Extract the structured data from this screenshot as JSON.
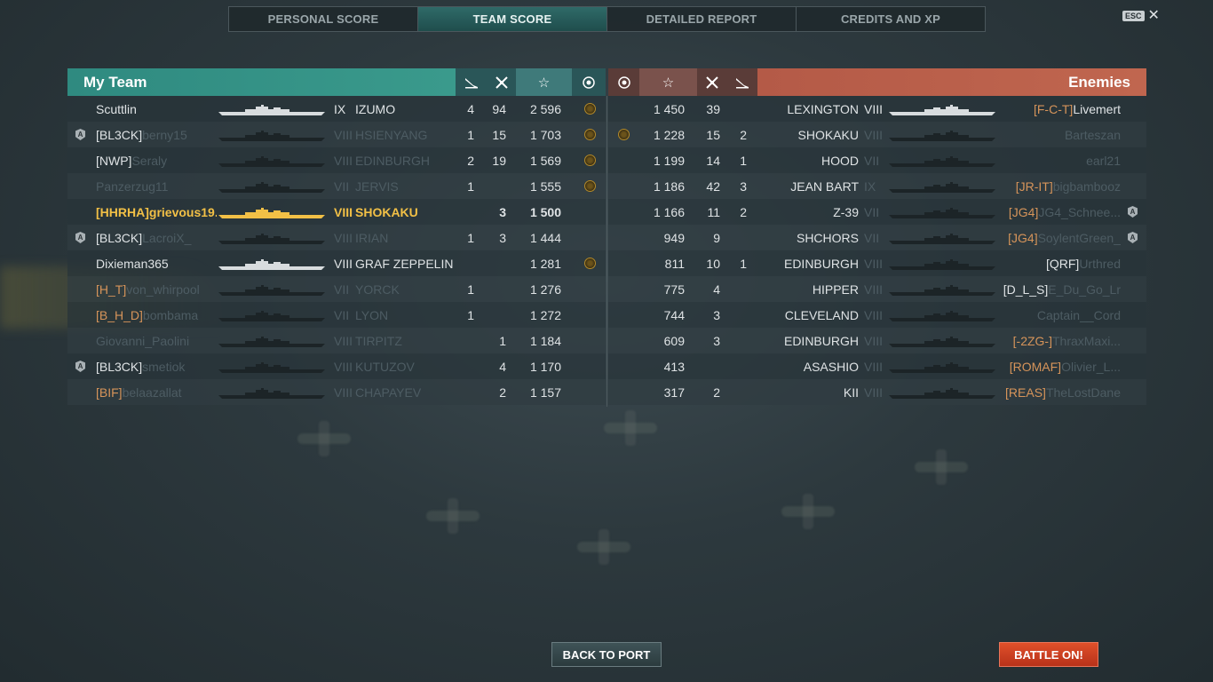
{
  "tabs": [
    "PERSONAL SCORE",
    "TEAM SCORE",
    "DETAILED REPORT",
    "CREDITS AND XP"
  ],
  "active_tab": 1,
  "esc": {
    "key": "ESC",
    "close": "✕"
  },
  "my_team": {
    "title": "My Team",
    "header_icons": [
      "torpedo-icon",
      "planes-shot-icon",
      "star-icon",
      "medal-icon"
    ],
    "rows": [
      {
        "badge": "",
        "tag": "",
        "tag_color": "white",
        "name": "Scuttlin",
        "name_style": "white",
        "tier": "IX",
        "ship": "IZUMO",
        "ship_style": "white",
        "torp": "4",
        "planes": "94",
        "score": "2 596",
        "medal": true,
        "sil": "light"
      },
      {
        "badge": "A",
        "tag": "[BL3CK]",
        "tag_color": "white",
        "name": "berny15",
        "name_style": "dim",
        "tier": "VIII",
        "ship": "HSIENYANG",
        "ship_style": "dim",
        "torp": "1",
        "planes": "15",
        "score": "1 703",
        "medal": true,
        "sil": "dark"
      },
      {
        "badge": "",
        "tag": "[NWP]",
        "tag_color": "white",
        "name": "Seraly",
        "name_style": "dim",
        "tier": "VIII",
        "ship": "EDINBURGH",
        "ship_style": "dim",
        "torp": "2",
        "planes": "19",
        "score": "1 569",
        "medal": true,
        "sil": "dark"
      },
      {
        "badge": "",
        "tag": "",
        "tag_color": "white",
        "name": "Panzerzug11",
        "name_style": "dim",
        "tier": "VII",
        "ship": "JERVIS",
        "ship_style": "dim",
        "torp": "1",
        "planes": "",
        "score": "1 555",
        "medal": true,
        "sil": "dark"
      },
      {
        "badge": "",
        "tag": "[HHRHA]",
        "tag_color": "self",
        "name": "grievous19...",
        "name_style": "self",
        "tier": "VIII",
        "ship": "SHOKAKU",
        "ship_style": "self",
        "torp": "",
        "planes": "3",
        "score": "1 500",
        "medal": false,
        "sil": "gold"
      },
      {
        "badge": "A",
        "tag": "[BL3CK]",
        "tag_color": "white",
        "name": "LacroiX_",
        "name_style": "dim",
        "tier": "VIII",
        "ship": "IRIAN",
        "ship_style": "dim",
        "torp": "1",
        "planes": "3",
        "score": "1 444",
        "medal": false,
        "sil": "dark"
      },
      {
        "badge": "",
        "tag": "",
        "tag_color": "white",
        "name": "Dixieman365",
        "name_style": "white",
        "tier": "VIII",
        "ship": "GRAF ZEPPELIN",
        "ship_style": "white",
        "torp": "",
        "planes": "",
        "score": "1 281",
        "medal": true,
        "sil": "light"
      },
      {
        "badge": "",
        "tag": "[H_T]",
        "tag_color": "orange",
        "name": "von_whirpool",
        "name_style": "dim",
        "tier": "VII",
        "ship": "YORCK",
        "ship_style": "dim",
        "torp": "1",
        "planes": "",
        "score": "1 276",
        "medal": false,
        "sil": "dark"
      },
      {
        "badge": "",
        "tag": "[B_H_D]",
        "tag_color": "orange",
        "name": "bombama",
        "name_style": "dim",
        "tier": "VII",
        "ship": "LYON",
        "ship_style": "dim",
        "torp": "1",
        "planes": "",
        "score": "1 272",
        "medal": false,
        "sil": "dark"
      },
      {
        "badge": "",
        "tag": "",
        "tag_color": "white",
        "name": "Giovanni_Paolini",
        "name_style": "dim",
        "tier": "VIII",
        "ship": "TIRPITZ",
        "ship_style": "dim",
        "torp": "",
        "planes": "1",
        "score": "1 184",
        "medal": false,
        "sil": "dark"
      },
      {
        "badge": "A",
        "tag": "[BL3CK]",
        "tag_color": "white",
        "name": "smetiok",
        "name_style": "dim",
        "tier": "VIII",
        "ship": "KUTUZOV",
        "ship_style": "dim",
        "torp": "",
        "planes": "4",
        "score": "1 170",
        "medal": false,
        "sil": "dark"
      },
      {
        "badge": "",
        "tag": "[BIF]",
        "tag_color": "orange",
        "name": "belaazallat",
        "name_style": "dim",
        "tier": "VIII",
        "ship": "CHAPAYEV",
        "ship_style": "dim",
        "torp": "",
        "planes": "2",
        "score": "1 157",
        "medal": false,
        "sil": "dark"
      }
    ]
  },
  "enemies": {
    "title": "Enemies",
    "header_icons": [
      "medal-icon",
      "star-icon",
      "planes-shot-icon",
      "torpedo-icon"
    ],
    "rows": [
      {
        "medal": false,
        "score": "1 450",
        "planes": "39",
        "torp": "",
        "ship": "LEXINGTON",
        "tier": "VIII",
        "ship_style": "white",
        "tag": "[F-C-T]",
        "tag_color": "orange",
        "name": "Livemert",
        "name_style": "white",
        "badge": "",
        "sil": "light"
      },
      {
        "medal": true,
        "score": "1 228",
        "planes": "15",
        "torp": "2",
        "ship": "SHOKAKU",
        "tier": "VIII",
        "ship_style": "dim",
        "tag": "",
        "tag_color": "white",
        "name": "Barteszan",
        "name_style": "dim",
        "badge": "",
        "sil": "dark"
      },
      {
        "medal": false,
        "score": "1 199",
        "planes": "14",
        "torp": "1",
        "ship": "HOOD",
        "tier": "VII",
        "ship_style": "dim",
        "tag": "",
        "tag_color": "white",
        "name": "earl21",
        "name_style": "dim",
        "badge": "",
        "sil": "dark"
      },
      {
        "medal": false,
        "score": "1 186",
        "planes": "42",
        "torp": "3",
        "ship": "JEAN BART",
        "tier": "IX",
        "ship_style": "dim",
        "tag": "[JR-IT]",
        "tag_color": "orange",
        "name": "bigbambooz",
        "name_style": "dim",
        "badge": "",
        "sil": "dark"
      },
      {
        "medal": false,
        "score": "1 166",
        "planes": "11",
        "torp": "2",
        "ship": "Z-39",
        "tier": "VII",
        "ship_style": "dim",
        "tag": "[JG4]",
        "tag_color": "orange",
        "name": "JG4_Schnee...",
        "name_style": "dim",
        "badge": "A",
        "sil": "dark"
      },
      {
        "medal": false,
        "score": "949",
        "planes": "9",
        "torp": "",
        "ship": "SHCHORS",
        "tier": "VII",
        "ship_style": "dim",
        "tag": "[JG4]",
        "tag_color": "orange",
        "name": "SoylentGreen_",
        "name_style": "dim",
        "badge": "A",
        "sil": "dark"
      },
      {
        "medal": false,
        "score": "811",
        "planes": "10",
        "torp": "1",
        "ship": "EDINBURGH",
        "tier": "VIII",
        "ship_style": "dim",
        "tag": "[QRF]",
        "tag_color": "white",
        "name": "Urthred",
        "name_style": "dim",
        "badge": "",
        "sil": "dark"
      },
      {
        "medal": false,
        "score": "775",
        "planes": "4",
        "torp": "",
        "ship": "HIPPER",
        "tier": "VIII",
        "ship_style": "dim",
        "tag": "[D_L_S]",
        "tag_color": "white",
        "name": "E_Du_Go_Lr",
        "name_style": "dim",
        "badge": "",
        "sil": "dark"
      },
      {
        "medal": false,
        "score": "744",
        "planes": "3",
        "torp": "",
        "ship": "CLEVELAND",
        "tier": "VIII",
        "ship_style": "dim",
        "tag": "",
        "tag_color": "white",
        "name": "Captain__Cord",
        "name_style": "dim",
        "badge": "",
        "sil": "dark"
      },
      {
        "medal": false,
        "score": "609",
        "planes": "3",
        "torp": "",
        "ship": "EDINBURGH",
        "tier": "VIII",
        "ship_style": "dim",
        "tag": "[-2ZG-]",
        "tag_color": "orange",
        "name": "ThraxMaxi...",
        "name_style": "dim",
        "badge": "",
        "sil": "dark"
      },
      {
        "medal": false,
        "score": "413",
        "planes": "",
        "torp": "",
        "ship": "ASASHIO",
        "tier": "VIII",
        "ship_style": "dim",
        "tag": "[ROMAF]",
        "tag_color": "orange",
        "name": "Olivier_L...",
        "name_style": "dim",
        "badge": "",
        "sil": "dark"
      },
      {
        "medal": false,
        "score": "317",
        "planes": "2",
        "torp": "",
        "ship": "KII",
        "tier": "VIII",
        "ship_style": "dim",
        "tag": "[REAS]",
        "tag_color": "orange",
        "name": "TheLostDane",
        "name_style": "dim",
        "badge": "",
        "sil": "dark"
      }
    ]
  },
  "buttons": {
    "back": "BACK TO PORT",
    "battle": "BATTLE ON!"
  },
  "colors": {
    "my_team": "#3a9a8c",
    "enemies": "#c0664f",
    "self": "#f2c046",
    "clan_orange": "#d6945a",
    "battle_button": "#d0401f"
  }
}
